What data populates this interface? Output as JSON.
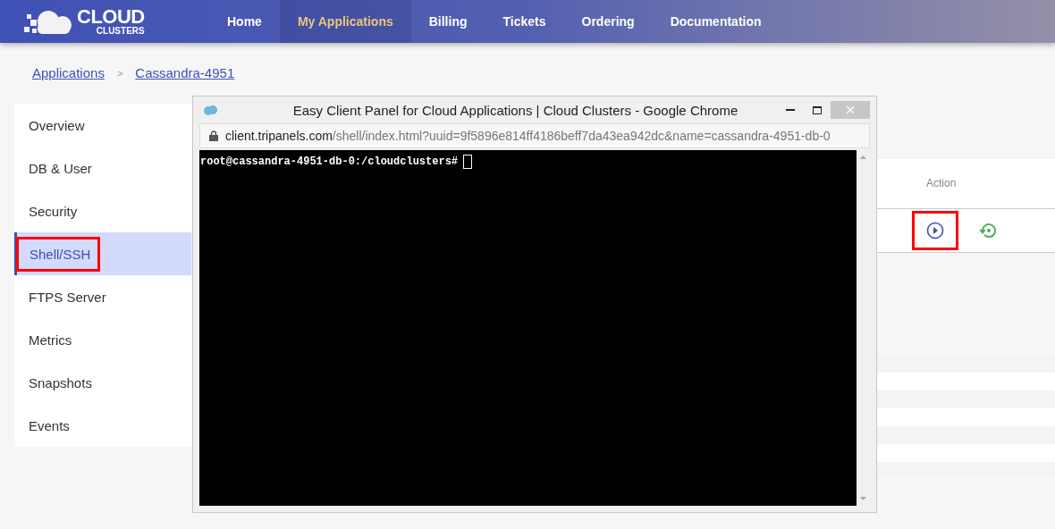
{
  "logo": {
    "line1": "CLOUD",
    "line2": "CLUSTERS"
  },
  "nav": [
    {
      "label": "Home",
      "selected": false
    },
    {
      "label": "My Applications",
      "selected": true
    },
    {
      "label": "Billing",
      "selected": false
    },
    {
      "label": "Tickets",
      "selected": false
    },
    {
      "label": "Ordering",
      "selected": false
    },
    {
      "label": "Documentation",
      "selected": false
    }
  ],
  "breadcrumb": {
    "items": [
      "Applications",
      "Cassandra-4951"
    ],
    "separator": ">"
  },
  "sidebar": {
    "items": [
      {
        "label": "Overview",
        "selected": false,
        "highlighted": false
      },
      {
        "label": "DB & User",
        "selected": false,
        "highlighted": false
      },
      {
        "label": "Security",
        "selected": false,
        "highlighted": false
      },
      {
        "label": "Shell/SSH",
        "selected": true,
        "highlighted": true
      },
      {
        "label": "FTPS Server",
        "selected": false,
        "highlighted": false
      },
      {
        "label": "Metrics",
        "selected": false,
        "highlighted": false
      },
      {
        "label": "Snapshots",
        "selected": false,
        "highlighted": false
      },
      {
        "label": "Events",
        "selected": false,
        "highlighted": false
      }
    ]
  },
  "table": {
    "columns": [
      "Action"
    ],
    "actions": [
      {
        "kind": "play",
        "highlighted": true
      },
      {
        "kind": "restart",
        "highlighted": false
      }
    ]
  },
  "popup": {
    "title": "Easy Client Panel for Cloud Applications | Cloud Clusters - Google Chrome",
    "url": {
      "host": "client.tripanels.com",
      "path": "/shell/index.html?uuid=9f5896e814ff4186beff7da43ea942dc&name=cassandra-4951-db-0"
    },
    "terminal": {
      "prompt": "root@cassandra-4951-db-0:/cloudclusters#"
    }
  }
}
